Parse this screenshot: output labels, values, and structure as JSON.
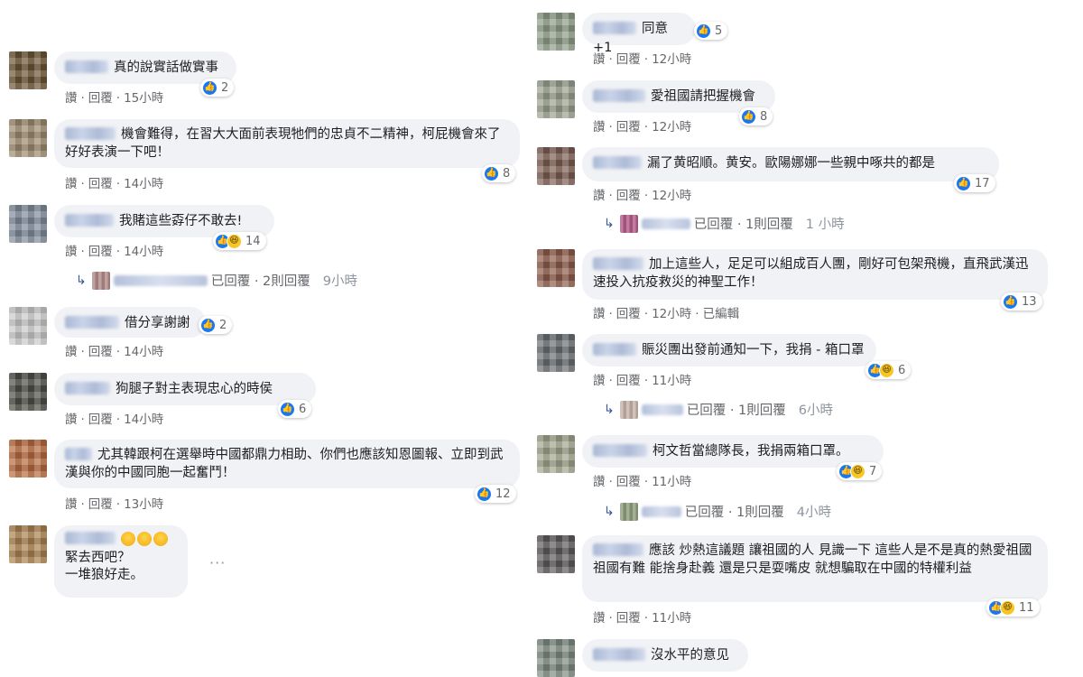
{
  "actions": {
    "like": "讚",
    "reply": "回覆",
    "dot": "·",
    "edited": "已編輯"
  },
  "left": [
    {
      "text": "真的說實話做實事",
      "time": "15小時",
      "like_count": "2"
    },
    {
      "text": "機會難得，在習大大面前表現牠們的忠貞不二精神，柯屁機會來了好好表演一下吧！",
      "time": "14小時",
      "like_count": "8"
    },
    {
      "text": "我賭這些孬仔不敢去!",
      "time": "14小時",
      "like_count": "14",
      "reply": {
        "label": "已回覆 · 2則回覆",
        "time": "9小時"
      }
    },
    {
      "text": "借分享謝謝",
      "time": "14小時",
      "like_count": "2"
    },
    {
      "text": "狗腿子對主表現忠心的時侯",
      "time": "14小時",
      "like_count": "6"
    },
    {
      "text": "尤其韓跟柯在選舉時中國都鼎力相助、你們也應該知恩圖報、立即到武漢與你的中國同胞一起奮鬥！",
      "time": "13小時",
      "like_count": "12"
    },
    {
      "line1": "緊去西吧？",
      "line2": "一堆狼好走。",
      "more": "···"
    }
  ],
  "right": [
    {
      "text": "同意+1",
      "time": "12小時",
      "like_count": "5"
    },
    {
      "text": "愛祖國請把握機會",
      "time": "12小時",
      "like_count": "8"
    },
    {
      "text": "漏了黄昭順。黄安。歐陽娜娜一些親中啄共的都是",
      "time": "12小時",
      "like_count": "17",
      "reply": {
        "label": "已回覆 · 1則回覆",
        "time": "1 小時"
      }
    },
    {
      "text": "加上這些人，足足可以組成百人團，剛好可包架飛機，直飛武漢迅速投入抗疫救災的神聖工作！",
      "time": "12小時",
      "like_count": "13"
    },
    {
      "text": "賑災團出發前通知一下，我捐 - 箱口罩",
      "time": "11小時",
      "like_count": "6",
      "reply": {
        "label": "已回覆 · 1則回覆",
        "time": "6小時"
      }
    },
    {
      "text": "柯文哲當總隊長，我捐兩箱口罩。",
      "time": "11小時",
      "like_count": "7",
      "reply": {
        "label": "已回覆 · 1則回覆",
        "time": "4小時"
      }
    },
    {
      "text": "應該 炒熱這議題 讓祖國的人 見識一下 這些人是不是真的熱愛祖國 祖國有難 能捨身赴義 還是只是耍嘴皮 就想騙取在中國的特權利益",
      "time": "11小時",
      "like_count": "11"
    },
    {
      "text": "沒水平的意见"
    }
  ],
  "colors": {
    "like": "#1877f2",
    "bubble": "#f0f2f5",
    "meta": "#65676b"
  }
}
